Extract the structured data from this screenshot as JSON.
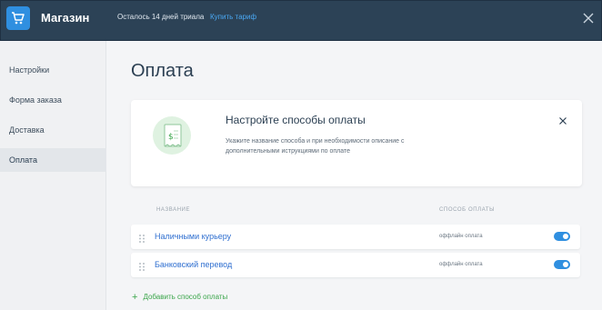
{
  "header": {
    "app_title": "Магазин",
    "trial_text": "Осталось 14 дней триала",
    "buy_link": "Купить тариф"
  },
  "sidebar": {
    "items": [
      {
        "label": "Настройки"
      },
      {
        "label": "Форма заказа"
      },
      {
        "label": "Доставка"
      },
      {
        "label": "Оплата",
        "active": true
      }
    ]
  },
  "main": {
    "title": "Оплата",
    "card": {
      "title": "Настройте способы оплаты",
      "description": "Укажите название способа и при необходимости описание с дополнительными иструкциями по оплате"
    },
    "table": {
      "columns": [
        "НАЗВАНИЕ",
        "СПОСОБ ОПЛАТЫ"
      ],
      "rows": [
        {
          "name": "Наличными курьеру",
          "method": "оффлайн оплата",
          "enabled": true
        },
        {
          "name": "Банковский перевод",
          "method": "оффлайн оплата",
          "enabled": true
        }
      ]
    },
    "add_label": "Добавить способ оплаты"
  },
  "colors": {
    "topbar": "#2c4256",
    "accent": "#2f8fe0",
    "link": "#2f6fd0",
    "add": "#3aa54a"
  }
}
